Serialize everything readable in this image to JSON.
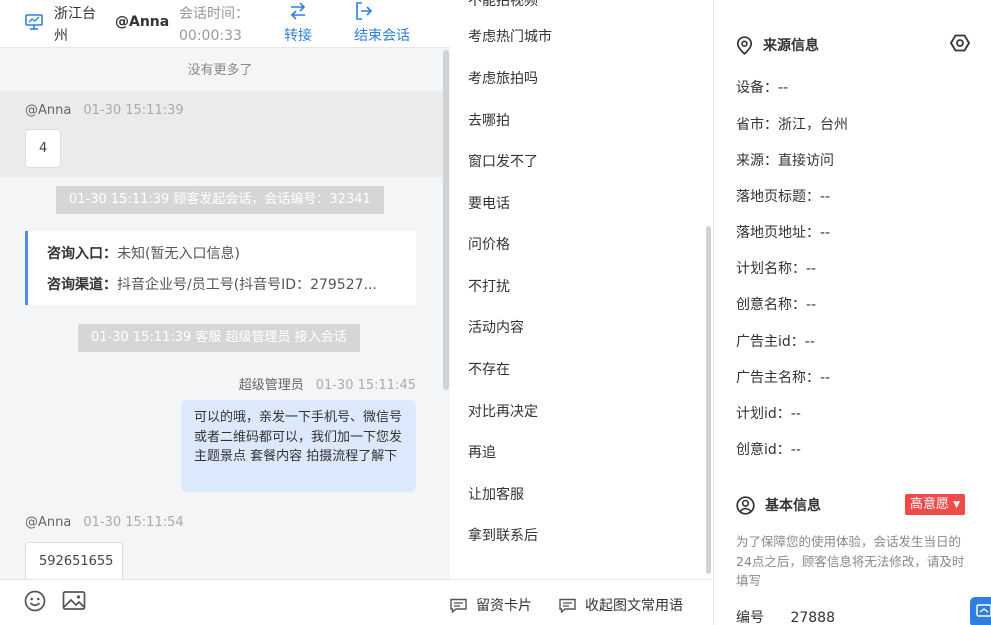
{
  "header": {
    "location": "浙江台州",
    "user": "@Anna",
    "session_time_label": "会话时间：",
    "session_time_value": "00:00:33",
    "transfer_label": "转接",
    "end_label": "结束会话"
  },
  "chat": {
    "no_more": "没有更多了",
    "messages": [
      {
        "name": "@Anna",
        "time": "01-30 15:11:39",
        "text": "4"
      },
      {
        "name": "超级管理员",
        "time": "01-30 15:11:45",
        "text": "可以的哦，亲发一下手机号、微信号或者二维码都可以，我们加一下您发主题景点 套餐内容 拍摄流程了解下"
      },
      {
        "name": "@Anna",
        "time": "01-30 15:11:54",
        "text": "592651655"
      }
    ],
    "system_tips": [
      "01-30 15:11:39 顾客发起会话，会话编号：32341",
      "01-30 15:11:39 客服 超级管理员 接入会话"
    ],
    "entry_card": {
      "entry_key": "咨询入口：",
      "entry_val": "未知(暂无入口信息)",
      "channel_key": "咨询渠道：",
      "channel_val": "抖音企业号/员工号(抖音号ID：279527..."
    }
  },
  "phrases": {
    "partial_top": "不能拍视频",
    "items": [
      "考虑热门城市",
      "考虑旅拍吗",
      "去哪拍",
      "窗口发不了",
      "要电话",
      "问价格",
      "不打扰",
      "活动内容",
      "不存在",
      "对比再决定",
      "再追",
      "让加客服",
      "拿到联系后"
    ],
    "card_button": "留资卡片",
    "collapse_button": "收起图文常用语"
  },
  "source_info": {
    "title": "来源信息",
    "fields": [
      "设备：--",
      "省市：浙江，台州",
      "来源：直接访问",
      "落地页标题：--",
      "落地页地址：--",
      "计划名称：--",
      "创意名称：--",
      "广告主id：--",
      "广告主名称：--",
      "计划id：--",
      "创意id：--"
    ]
  },
  "basic_info": {
    "title": "基本信息",
    "intent_badge": "高意愿",
    "notice": "为了保障您的使用体验，会话发生当日的24点之后，顾客信息将无法修改，请及时填写",
    "id_label": "编号",
    "id_value": "27888"
  },
  "colors": {
    "accent": "#2e7fe0",
    "badge_red": "#f04b4b",
    "out_bubble": "#dce8fb",
    "card_border": "#4a8ff0"
  },
  "icons": [
    "monitor-icon",
    "transfer-icon",
    "exit-icon",
    "emoji-icon",
    "image-icon",
    "card-icon",
    "collapse-icon",
    "location-pin-icon",
    "settings-hex-icon",
    "user-circle-icon",
    "caret-down-icon",
    "chat-float-icon"
  ]
}
